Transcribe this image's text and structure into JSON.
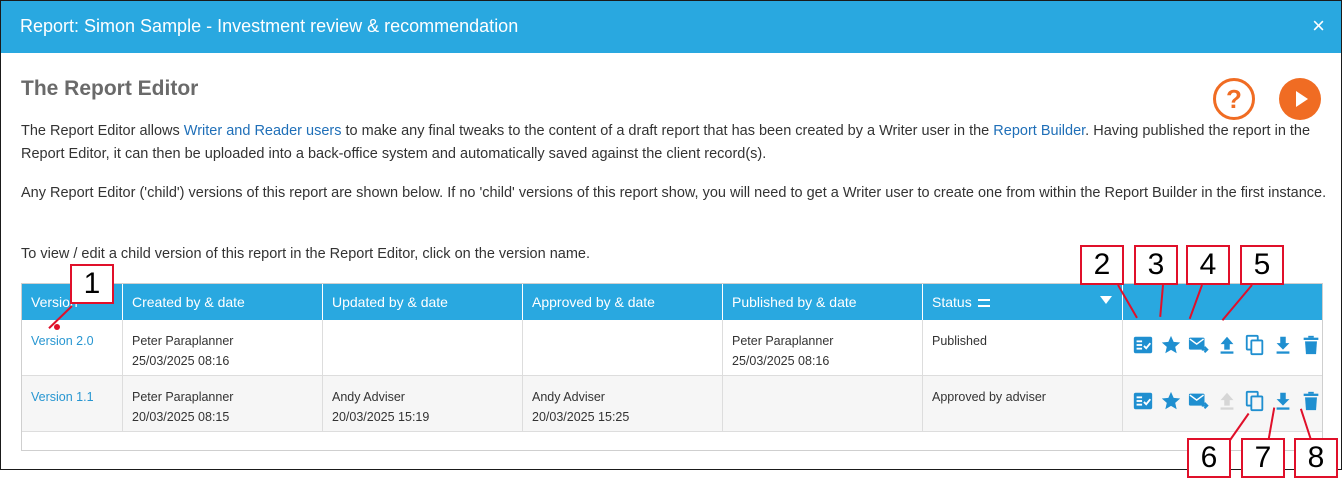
{
  "dialog": {
    "title": "Report: Simon Sample - Investment review & recommendation",
    "close_glyph": "×"
  },
  "page": {
    "heading": "The Report Editor",
    "help_glyph": "?",
    "para1": {
      "t1": "The Report Editor allows ",
      "link1": "Writer and Reader users",
      "t2": " to make any final tweaks to the content of a draft report that has been created by a Writer user in the ",
      "link2": "Report Builder",
      "t3": ". Having published the report in the Report Editor, it can then be uploaded into a back-office system and automatically saved against the client record(s)."
    },
    "para2": "Any Report Editor ('child') versions of this report are shown below. If no 'child' versions of this report show, you will need to get a Writer user to create one from within the Report Builder in the first instance.",
    "para3": "To view / edit a child version of this report in the Report Editor, click on the version name."
  },
  "table": {
    "headers": [
      "Version",
      "Created by & date",
      "Updated by & date",
      "Approved by & date",
      "Published by & date",
      "Status",
      ""
    ],
    "rows": [
      {
        "version": "Version 2.0",
        "created_by": "Peter Paraplanner",
        "created_date": "25/03/2025 08:16",
        "updated_by": "",
        "updated_date": "",
        "approved_by": "",
        "approved_date": "",
        "published_by": "Peter Paraplanner",
        "published_date": "25/03/2025 08:16",
        "status": "Published",
        "upload_enabled": true
      },
      {
        "version": "Version 1.1",
        "created_by": "Peter Paraplanner",
        "created_date": "20/03/2025 08:15",
        "updated_by": "Andy Adviser",
        "updated_date": "20/03/2025 15:19",
        "approved_by": "Andy Adviser",
        "approved_date": "20/03/2025 15:25",
        "published_by": "",
        "published_date": "",
        "status": "Approved by adviser",
        "upload_enabled": false
      }
    ],
    "action_icons": [
      "checklist-icon",
      "star-icon",
      "email-forward-icon",
      "upload-icon",
      "copy-icon",
      "download-icon",
      "delete-icon"
    ]
  },
  "callouts": [
    "1",
    "2",
    "3",
    "4",
    "5",
    "6",
    "7",
    "8"
  ],
  "colors": {
    "header_blue": "#29a8e0",
    "accent_orange": "#f06c23",
    "link_blue": "#1f6fb8",
    "icon_blue": "#1f8fd0",
    "callout_red": "#e0102a"
  }
}
